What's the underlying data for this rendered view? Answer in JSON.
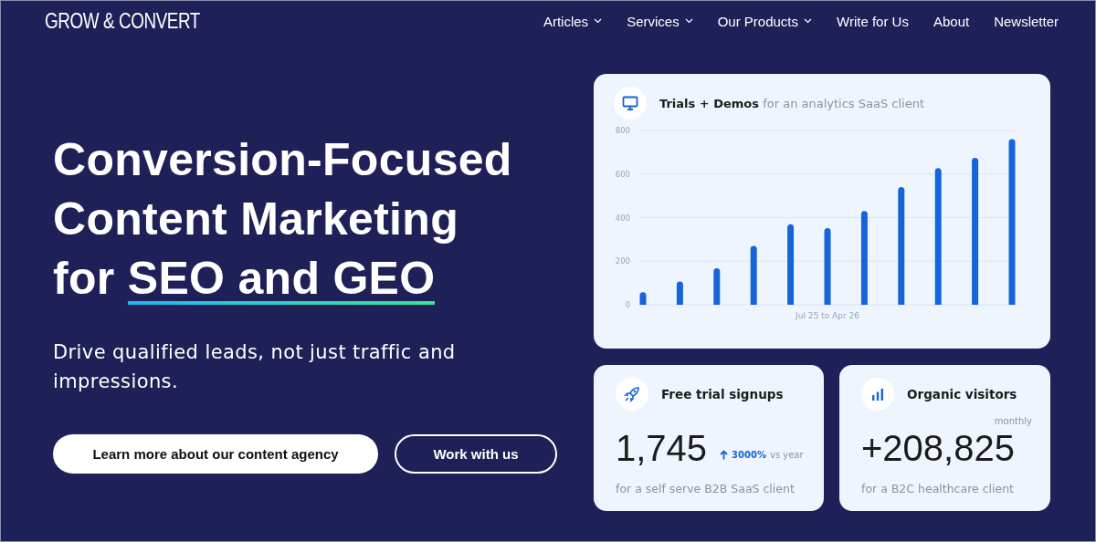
{
  "logo": "GROW & CONVERT",
  "nav": [
    {
      "label": "Articles",
      "dropdown": true
    },
    {
      "label": "Services",
      "dropdown": true
    },
    {
      "label": "Our Products",
      "dropdown": true
    },
    {
      "label": "Write for Us",
      "dropdown": false
    },
    {
      "label": "About",
      "dropdown": false
    },
    {
      "label": "Newsletter",
      "dropdown": false
    }
  ],
  "hero": {
    "headline": "Conversion-Focused Content Marketing for",
    "headline_highlight": "SEO and GEO",
    "subtitle": "Drive qualified leads, not just traffic and impressions.",
    "buttons": [
      {
        "label": "Learn more about our content agency",
        "kind": "primary"
      },
      {
        "label": "Work with us",
        "kind": "outline"
      }
    ]
  },
  "chart_card": {
    "title": "Trials + Demos",
    "subtitle": "for an analytics SaaS client",
    "chart_data": {
      "type": "bar",
      "grid": true,
      "xlabel": "Jul 25 to Apr 26",
      "ylim": [
        0,
        800
      ],
      "yticks": [
        0,
        200,
        400,
        600,
        800
      ],
      "values": [
        55,
        105,
        165,
        268,
        368,
        350,
        428,
        538,
        625,
        672,
        758
      ]
    }
  },
  "stat_cards": [
    {
      "title": "Free trial signups",
      "value": "1,745",
      "change": "3000%",
      "change_label": "vs year",
      "caption": "for a self serve B2B SaaS client"
    },
    {
      "title": "Organic visitors",
      "period": "monthly",
      "value": "+208,825",
      "caption": "for a B2C healthcare client"
    }
  ]
}
